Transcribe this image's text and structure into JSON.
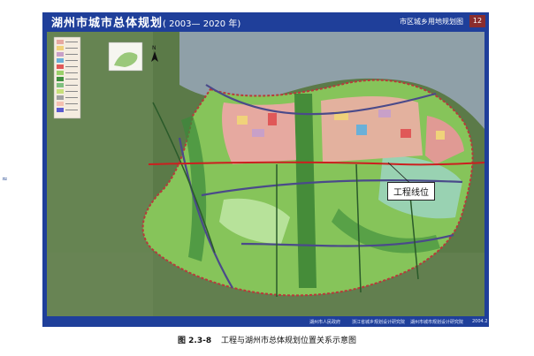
{
  "page": {
    "margin_mark": "≈"
  },
  "map": {
    "title": "湖州市城市总体规划",
    "period": "( 2003— 2020 年)",
    "subtitle": "市区城乡用地规划图",
    "sheet_number": "12",
    "callout_label": "工程线位",
    "compass_label": "N",
    "footer": {
      "org_1": "湖州市人民政府",
      "org_2": "浙江省城乡规划设计研究院",
      "org_3": "湖州市城市规划设计研究院",
      "date": "2004.2"
    },
    "colors": {
      "header_bg": "#1f3f9a",
      "lake": "#8fa0a8",
      "forest": "#5d7d4a",
      "rural_green": "#86c45a",
      "urban_pink": "#e6a9a0",
      "route_red": "#cc1f1f",
      "boundary_red": "#b83a3a"
    },
    "legend": {
      "swatches": [
        "#e6a9a0",
        "#f0d27a",
        "#c8a0c8",
        "#6ab0d8",
        "#e05858",
        "#9ad06a",
        "#3f8f3f",
        "#7fc07f",
        "#c8e07a",
        "#a0a0a0",
        "#f5c0b0",
        "#5a5ad0"
      ]
    }
  },
  "caption": {
    "figure_number": "图 2.3-8",
    "figure_title": "工程与湖州市总体规划位置关系示意图"
  }
}
